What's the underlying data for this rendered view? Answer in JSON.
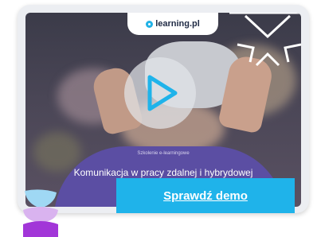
{
  "logo": {
    "text": "learning.pl"
  },
  "video": {
    "subtitle": "Szkolenie e-learningowe",
    "title": "Komunikacja w pracy zdalnej i hybrydowej"
  },
  "cta": {
    "label": "Sprawdź demo"
  },
  "colors": {
    "brand_blue": "#1fb3ea",
    "caption_purple": "#5b4ea3",
    "deco_violet": "#a236d8",
    "deco_light": "#9fd8f4"
  },
  "icons": {
    "play": "play-icon",
    "fullscreen": "fullscreen-arrows-icon",
    "logo_mark": "logo-dot-icon",
    "decoration": "stacked-shapes-icon"
  }
}
